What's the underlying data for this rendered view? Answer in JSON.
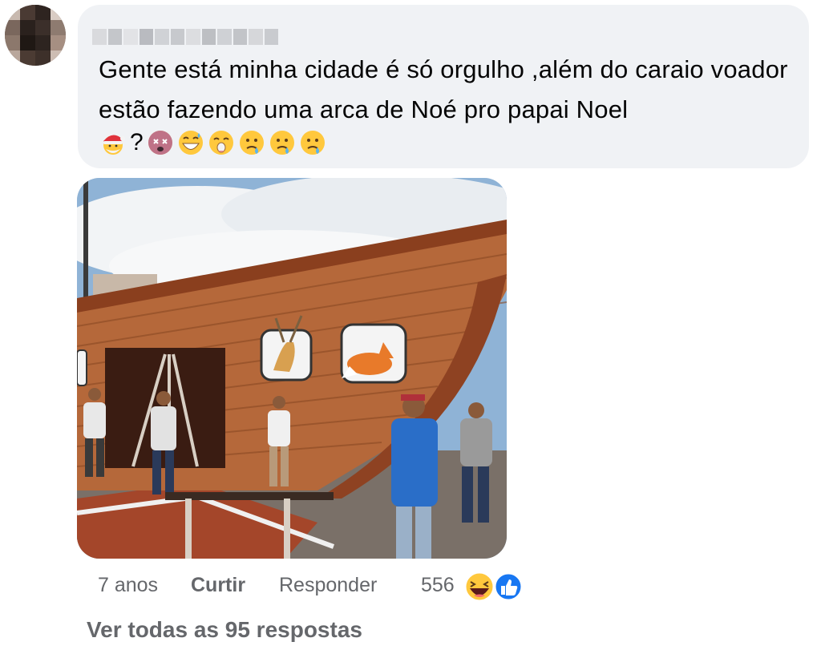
{
  "comment": {
    "text": "Gente está minha cidade é só orgulho ,além do caraio voador estão fazendo uma arca de Noé pro papai Noel",
    "emoji_sequence": [
      "santa-emoji",
      "?",
      "dizzy-face-emoji",
      "grinning-sweat-emoji",
      "hushed-face-emoji",
      "sweat-face-emoji",
      "sweat-face-emoji",
      "sweat-face-emoji"
    ]
  },
  "photo": {
    "description_icons": [
      "deer-panel",
      "fox-panel"
    ]
  },
  "actions": {
    "time": "7 anos",
    "like": "Curtir",
    "reply": "Responder",
    "reaction_count": "556",
    "reactions": [
      "haha-reaction-icon",
      "like-reaction-icon"
    ]
  },
  "view_all_replies": "Ver todas as 95 respostas",
  "colors": {
    "bubble_bg": "#f0f2f5",
    "muted_text": "#65676b",
    "like_blue": "#1877f2"
  }
}
